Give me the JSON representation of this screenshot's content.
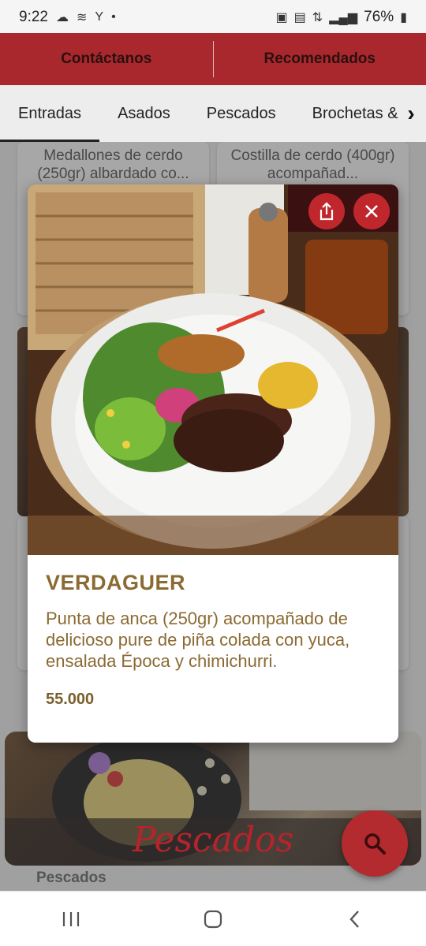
{
  "status": {
    "time": "9:22",
    "battery": "76%"
  },
  "topbar": {
    "contact_label": "Contáctanos",
    "recommended_label": "Recomendados"
  },
  "tabs": [
    "Entradas",
    "Asados",
    "Pescados",
    "Brochetas &"
  ],
  "background_cards": [
    {
      "text": "Medallones de cerdo (250gr) albardado co..."
    },
    {
      "text": "Costilla de cerdo (400gr) acompañad..."
    }
  ],
  "category": {
    "banner_title": "Pescados",
    "label": "Pescados"
  },
  "modal": {
    "title": "VERDAGUER",
    "description": "Punta de anca (250gr) acompañado de delicioso pure de piña colada con yuca, ensalada Época y chimichurri.",
    "price": "55.000"
  },
  "colors": {
    "brand": "#a9282d",
    "accent_text": "#8b6a33"
  }
}
